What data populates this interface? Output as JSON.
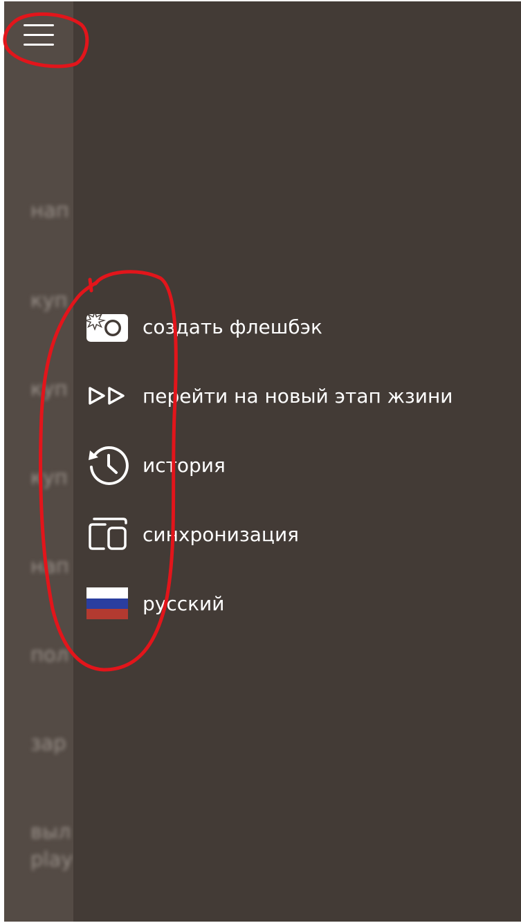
{
  "header": {
    "menu_icon": "hamburger-icon"
  },
  "background_list": {
    "items": [
      "нап",
      "куп",
      "куп",
      "куп",
      "нап",
      "пол",
      "зар",
      "выл",
      "play"
    ]
  },
  "menu": {
    "items": [
      {
        "icon": "camera-flash-icon",
        "label": "создать флешбэк"
      },
      {
        "icon": "fast-forward-icon",
        "label": "перейти на новый этап жзини"
      },
      {
        "icon": "history-icon",
        "label": "история"
      },
      {
        "icon": "devices-sync-icon",
        "label": "синхронизация"
      },
      {
        "icon": "russian-flag-icon",
        "label": "русский"
      }
    ]
  },
  "colors": {
    "drawer_background": "#433b36",
    "strip_background": "#544b45",
    "text": "#ffffff",
    "annotation": "#e2151b",
    "flag_white": "#ffffff",
    "flag_blue": "#2a3ea0",
    "flag_red": "#b33a30"
  }
}
